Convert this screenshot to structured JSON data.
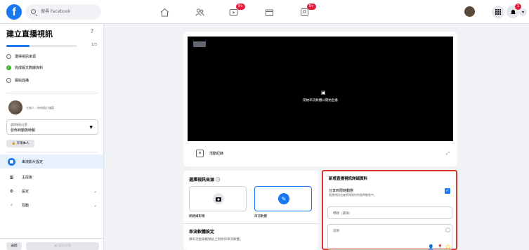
{
  "topbar": {
    "logo": "f",
    "search_placeholder": "搜尋 Facebook",
    "nav_icons": [
      "home-icon",
      "friends-icon",
      "watch-icon",
      "marketplace-icon",
      "groups-icon"
    ],
    "badges": {
      "watch": "9+",
      "groups": "9+",
      "notifications": "1"
    },
    "right_icons": [
      "menu-grid-icon",
      "messenger-icon",
      "notification-icon",
      "account-chevron-icon"
    ]
  },
  "sidebar": {
    "title": "建立直播視訊",
    "help": "?",
    "progress_text": "1/3",
    "progress_fraction": 0.33,
    "steps": [
      {
        "label": "選擇視訊來源",
        "state": "pending"
      },
      {
        "label": "完成版文數據資料",
        "state": "done"
      },
      {
        "label": "開始直播",
        "state": "pending"
      }
    ],
    "user_text": "主辦人・你的個人檔案",
    "select": {
      "label": "選擇張貼位置",
      "value": "發佈到動態時報"
    },
    "privacy_label": "只限本人",
    "menu": [
      {
        "label": "串流影片設定",
        "icon": "video-camera-icon",
        "active": true
      },
      {
        "label": "主控板",
        "icon": "dashboard-icon",
        "active": false
      },
      {
        "label": "設定",
        "icon": "gear-icon",
        "active": false,
        "chevron": true
      },
      {
        "label": "互動",
        "icon": "interaction-icon",
        "active": false,
        "chevron": true
      }
    ],
    "back_label": "返回",
    "go_live_label": "開始直播"
  },
  "main": {
    "video_message": "開始串流軟體以開始直播",
    "activity_log": "活動紀錄"
  },
  "source": {
    "title": "選擇視訊來源",
    "options": [
      {
        "label": "網路攝影機",
        "icon": "camera-icon",
        "selected": false
      },
      {
        "label": "串流軟體",
        "icon": "stream-key-icon",
        "selected": true
      }
    ],
    "stream_title": "串流軟體設定",
    "stream_desc": "將串流金鑰複製貼上到你的串流軟體。"
  },
  "details": {
    "title": "新增直播視訊詳細資料",
    "share_label": "分享到限時動態",
    "share_sub": "直播視訊也會新增到你的限時動態中。",
    "share_checked": true,
    "title_placeholder": "標題（選填）",
    "desc_placeholder": "說明"
  },
  "colors": {
    "brand": "#1877f2",
    "highlight": "#d73a2d",
    "done": "#42b72a"
  }
}
